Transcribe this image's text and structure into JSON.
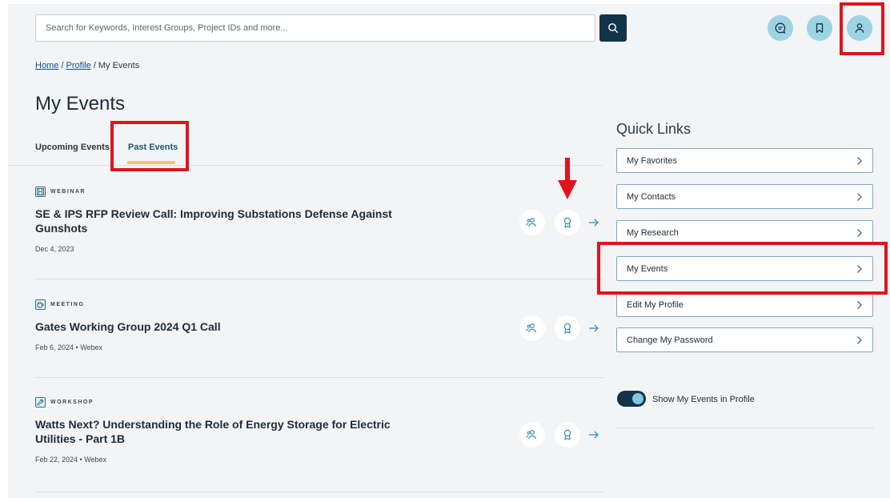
{
  "header": {
    "search_placeholder": "Search for Keywords, Interest Groups, Project IDs and more...",
    "icons": {
      "search": "search-icon",
      "chat": "chat-icon",
      "bookmark": "bookmark-icon",
      "user": "user-icon"
    }
  },
  "breadcrumb": {
    "home": "Home",
    "sep1": " / ",
    "profile": "Profile",
    "sep2": " / ",
    "current": "My Events"
  },
  "page_title": "My Events",
  "tabs": [
    {
      "label": "Upcoming Events",
      "active": false
    },
    {
      "label": "Past Events",
      "active": true
    }
  ],
  "events": [
    {
      "type": "WEBINAR",
      "icon": "film-icon",
      "title": "SE & IPS RFP Review Call: Improving Substations Defense Against Gunshots",
      "meta": "Dec 4, 2023"
    },
    {
      "type": "MEETING",
      "icon": "coffee-icon",
      "title": "Gates Working Group 2024 Q1 Call",
      "meta": "Feb 6, 2024 • Webex"
    },
    {
      "type": "WORKSHOP",
      "icon": "wrench-icon",
      "title": "Watts Next? Understanding the Role of Energy Storage for Electric Utilities - Part 1B",
      "meta": "Feb 22, 2024 • Webex"
    }
  ],
  "quick_links": {
    "title": "Quick Links",
    "items": [
      {
        "label": "My Favorites"
      },
      {
        "label": "My Contacts"
      },
      {
        "label": "My Research"
      },
      {
        "label": "My Events"
      },
      {
        "label": "Edit My Profile"
      },
      {
        "label": "Change My Password"
      }
    ]
  },
  "toggle": {
    "label": "Show My Events in Profile",
    "on": true
  },
  "colors": {
    "navy": "#13334a",
    "accent_blue": "#9ed3e3",
    "tab_underline": "#f0cc57",
    "annotation_red": "#e0141b"
  }
}
